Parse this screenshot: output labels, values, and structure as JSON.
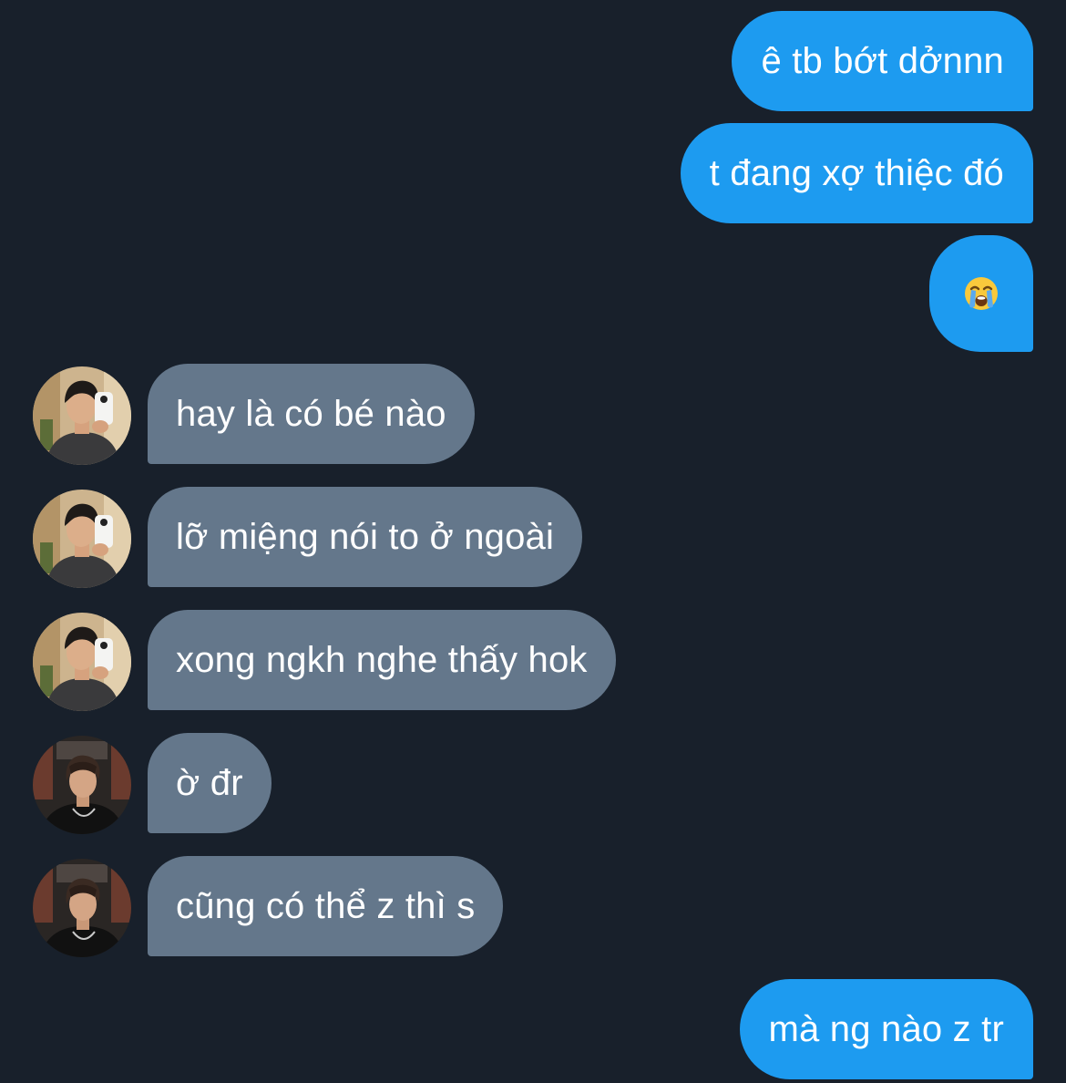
{
  "conversation": {
    "messages": [
      {
        "direction": "outgoing",
        "text": "ê tb bớt dởnnn"
      },
      {
        "direction": "outgoing",
        "text": "t đang xợ thiệc đó"
      },
      {
        "direction": "outgoing",
        "emoji": "loudly-crying-face"
      },
      {
        "direction": "incoming",
        "text": "hay là có bé nào",
        "avatar": "avatar-mirror-selfie"
      },
      {
        "direction": "incoming",
        "text": "lỡ miệng nói to ở ngoài",
        "avatar": "avatar-mirror-selfie"
      },
      {
        "direction": "incoming",
        "text": "xong ngkh nghe thấy hok",
        "avatar": "avatar-mirror-selfie"
      },
      {
        "direction": "incoming",
        "text": "ờ đr",
        "avatar": "avatar-dark-portrait"
      },
      {
        "direction": "incoming",
        "text": "cũng có thể z thì s",
        "avatar": "avatar-dark-portrait"
      },
      {
        "direction": "outgoing",
        "text": "mà ng nào z tr"
      }
    ]
  },
  "colors": {
    "background": "#18202b",
    "outgoing_bubble": "#1d9bf0",
    "incoming_bubble": "#64778b",
    "text": "#ffffff"
  }
}
